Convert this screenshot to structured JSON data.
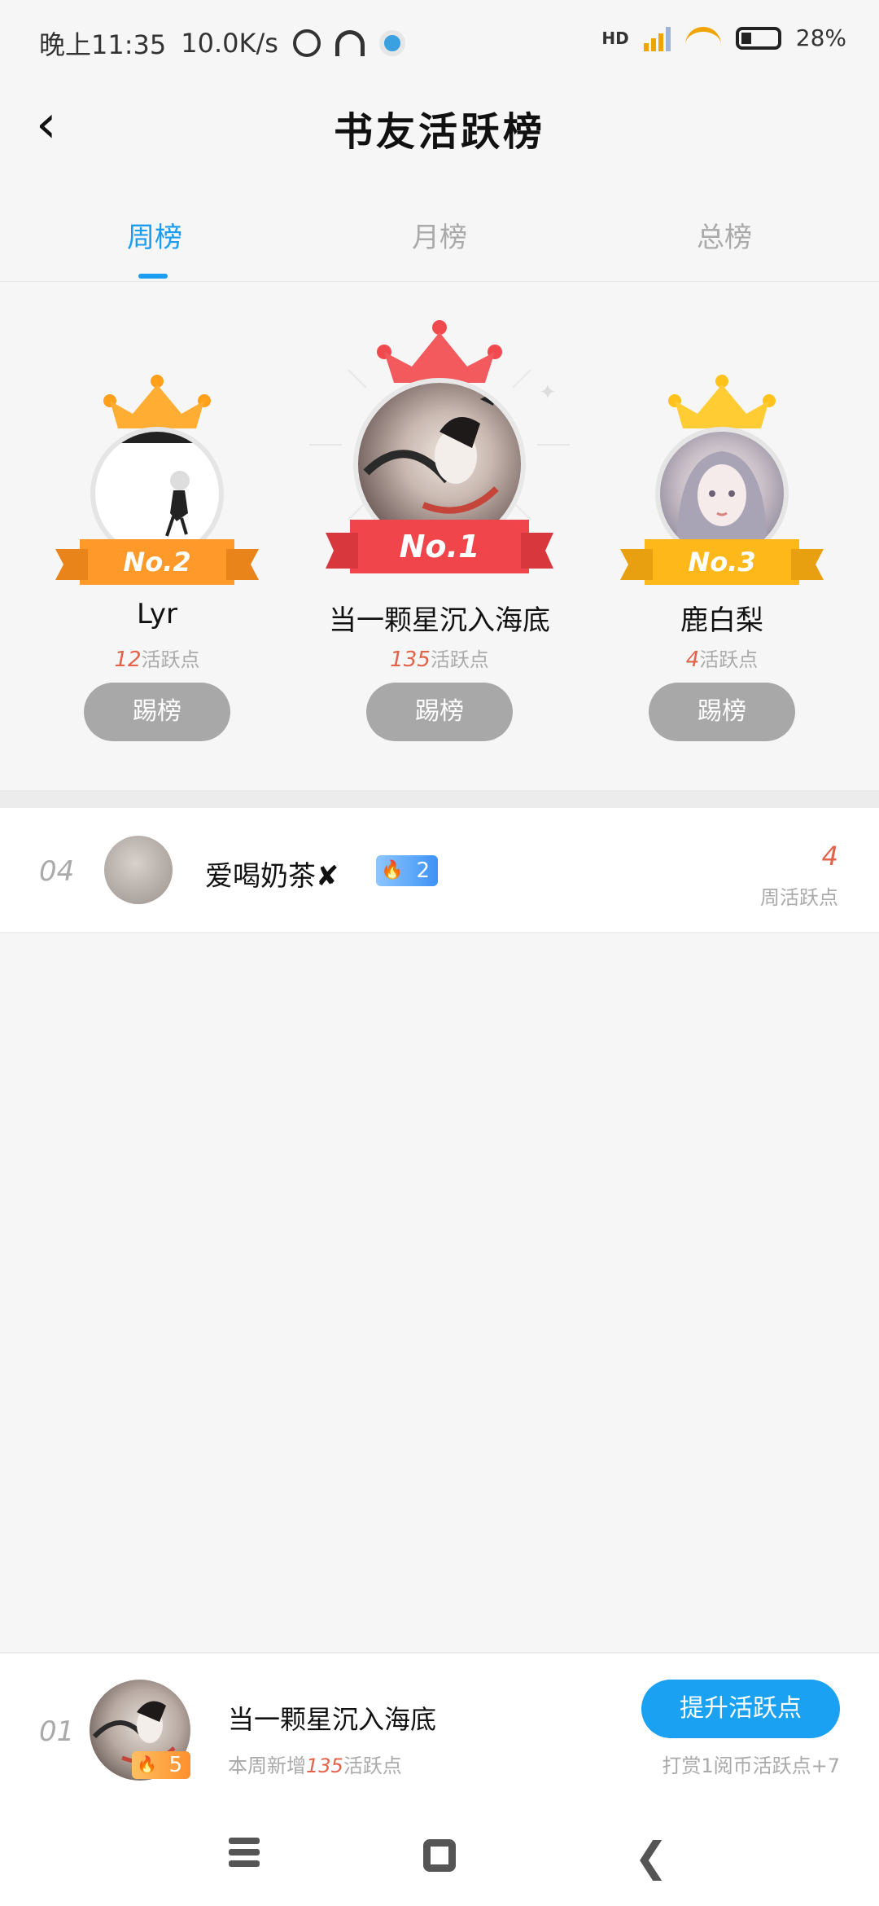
{
  "status_bar": {
    "time": "晚上11:35",
    "speed": "10.0K/s",
    "network": "HD",
    "battery": "28%"
  },
  "header": {
    "title": "书友活跃榜"
  },
  "tabs": [
    {
      "label": "周榜",
      "active": true
    },
    {
      "label": "月榜",
      "active": false
    },
    {
      "label": "总榜",
      "active": false
    }
  ],
  "podium": {
    "first": {
      "rank": "No.1",
      "name": "当一颗星沉入海底",
      "points": "135",
      "points_label": "活跃点",
      "button": "踢榜"
    },
    "second": {
      "rank": "No.2",
      "name": "Lyr",
      "points": "12",
      "points_label": "活跃点",
      "button": "踢榜"
    },
    "third": {
      "rank": "No.3",
      "name": "鹿白梨",
      "points": "4",
      "points_label": "活跃点",
      "button": "踢榜"
    }
  },
  "list": [
    {
      "rank": "04",
      "name": "爱喝奶茶✘",
      "badge": "2",
      "points": "4",
      "points_label": "周活跃点"
    }
  ],
  "my_entry": {
    "rank": "01",
    "badge": "5",
    "name": "当一颗星沉入海底",
    "sub_prefix": "本周新增",
    "sub_points": "135",
    "sub_suffix": "活跃点",
    "button": "提升活跃点",
    "hint": "打赏1阅币活跃点+7"
  },
  "colors": {
    "accent": "#1a9cf0",
    "points": "#e2624a",
    "gold": "#ff9f1a",
    "red": "#f04a4f"
  }
}
